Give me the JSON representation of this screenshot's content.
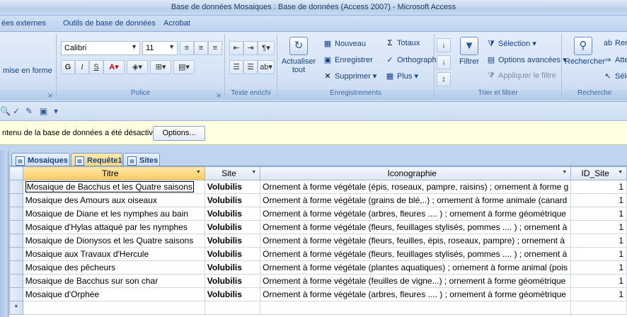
{
  "window": {
    "title": "Base de données Mosaiques : Base de données (Access 2007) - Microsoft Access"
  },
  "ribbon_tabs": [
    "ées externes",
    "Outils de base de données",
    "Acrobat"
  ],
  "ribbon": {
    "group_mise_en_forme": {
      "label": "mise en forme"
    },
    "police": {
      "label": "Police",
      "font_name": "Calibri",
      "font_size": "11",
      "bold": "G",
      "italic": "I",
      "underline": "S"
    },
    "texte_enrichi": {
      "label": "Texte enrichi"
    },
    "enregistrements": {
      "label": "Enregistrements",
      "refresh": "Actualiser tout",
      "new": "Nouveau",
      "save": "Enregistrer",
      "delete": "Supprimer",
      "totals": "Totaux",
      "spelling": "Orthographe",
      "more": "Plus"
    },
    "trier_filtrer": {
      "label": "Trier et filtrer",
      "filter": "Filtrer",
      "selection": "Sélection",
      "advanced": "Options avancées",
      "apply": "Appliquer le filtre"
    },
    "rechercher": {
      "label": "Recherche",
      "find": "Rechercher",
      "replace": "Rem",
      "goto": "Atte",
      "select": "Séle"
    }
  },
  "message_bar": {
    "text": "ntenu de la base de données a été désactivé",
    "options_button": "Options..."
  },
  "document_tabs": [
    {
      "label": "Mosaiques",
      "active": false
    },
    {
      "label": "Requête1",
      "active": true
    },
    {
      "label": "Sites",
      "active": false
    }
  ],
  "datasheet": {
    "columns": [
      "Titre",
      "Site",
      "Iconographie",
      "ID_Site"
    ],
    "rows": [
      {
        "titre": "Mosaique de Bacchus et les Quatre saisons",
        "site": "Volubilis",
        "icono": "Ornement à forme végétale (épis, roseaux, pampre, raisins) ; ornement à forme g",
        "id": "1"
      },
      {
        "titre": "Mosaique des Amours aux oiseaux",
        "site": "Volubilis",
        "icono": "Ornement à forme végétale  (grains de blé,..) ; ornement à forme animale (canard",
        "id": "1"
      },
      {
        "titre": "Mosaique de  Diane et les nymphes au bain",
        "site": "Volubilis",
        "icono": "Ornement à forme végétale (arbres, fleures .... ) ; ornement à forme géométrique",
        "id": "1"
      },
      {
        "titre": "Mosaique d'Hylas attaqué par les nymphes",
        "site": "Volubilis",
        "icono": "Ornement à forme végétale (fleurs, feuillages stylisés, pommes .... ) ; ornement à",
        "id": "1"
      },
      {
        "titre": "Mosaique de Dionysos et les Quatre saisons",
        "site": "Volubilis",
        "icono": "Ornement à forme végétale (fleurs, feuilles, épis, roseaux, pampre) ; ornement à",
        "id": "1"
      },
      {
        "titre": "Mosaique aux Travaux d'Hercule",
        "site": "Volubilis",
        "icono": "Ornement à forme végétale (fleurs, feuillages stylisés, pommes .... ) ; ornement à",
        "id": "1"
      },
      {
        "titre": "Mosaique  des pêcheurs",
        "site": "Volubilis",
        "icono": "Ornement à forme végétale (plantes aquatiques) ; ornement à forme animal (pois",
        "id": "1"
      },
      {
        "titre": "Mosaique de Bacchus sur son char",
        "site": "Volubilis",
        "icono": "Ornement à forme végétale (feuilles de vigne...) ; ornement à forme géométrique",
        "id": "1"
      },
      {
        "titre": "Mosaique d'Orphée",
        "site": "Volubilis",
        "icono": "Ornement à forme végétale (arbres, fleures .... ) ; ornement à forme géométrique",
        "id": "1"
      }
    ],
    "new_row_marker": "*"
  }
}
